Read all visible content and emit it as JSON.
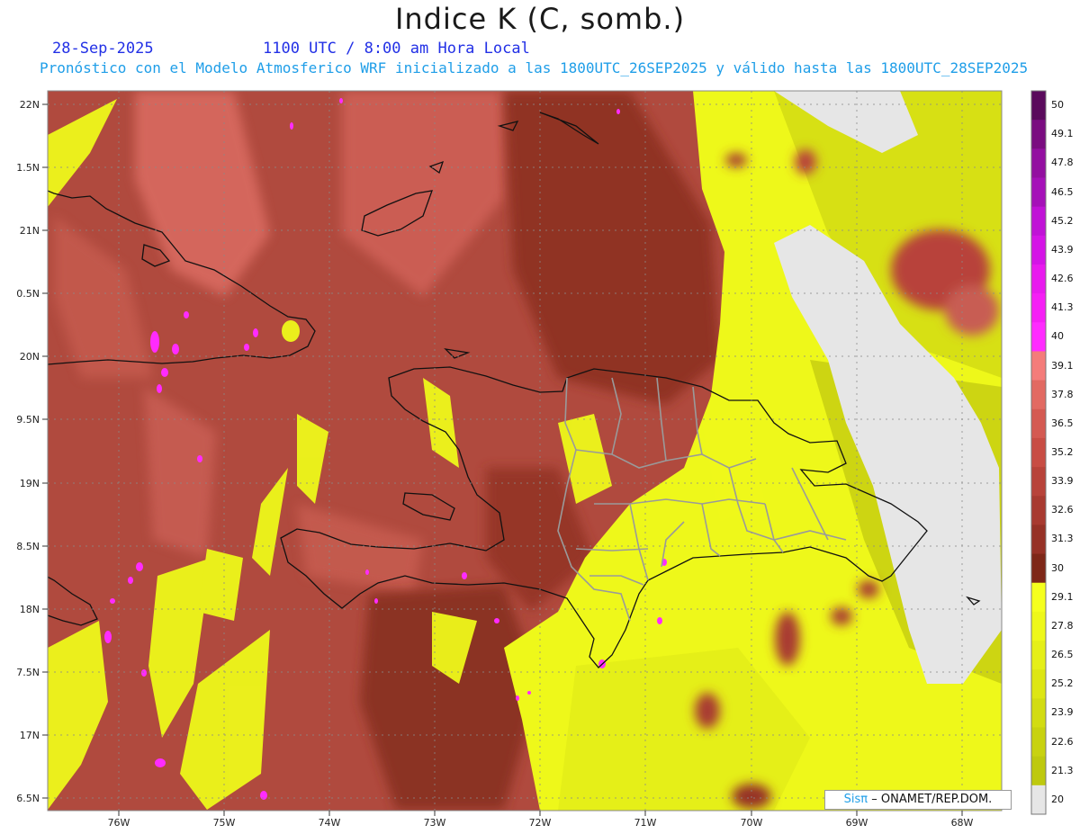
{
  "header": {
    "title": "Indice K (C, somb.)",
    "date": "28-Sep-2025",
    "time": "1100 UTC / 8:00 am Hora Local",
    "subtitle": "Pronóstico con el Modelo Atmosferico WRF inicializado a las 1800UTC_26SEP2025 y válido hasta las  1800UTC_28SEP2025"
  },
  "axes": {
    "lon_ticks": [
      "76W",
      "75W",
      "74W",
      "73W",
      "72W",
      "71W",
      "70W",
      "69W",
      "68W"
    ],
    "lat_ticks": [
      "22N",
      "1.5N",
      "21N",
      "0.5N",
      "20N",
      "9.5N",
      "19N",
      "8.5N",
      "18N",
      "7.5N",
      "17N",
      "6.5N"
    ]
  },
  "colorbar": {
    "labels": [
      "50",
      "49.1",
      "47.8",
      "46.5",
      "45.2",
      "43.9",
      "42.6",
      "41.3",
      "40",
      "39.1",
      "37.8",
      "36.5",
      "35.2",
      "33.9",
      "32.6",
      "31.3",
      "30",
      "29.1",
      "27.8",
      "26.5",
      "25.2",
      "23.9",
      "22.6",
      "21.3",
      "20"
    ],
    "colors": [
      "#5a0a5c",
      "#7a0c80",
      "#930fa0",
      "#a511b8",
      "#c012d6",
      "#d414e6",
      "#e81aee",
      "#f51ff5",
      "#ff2bff",
      "#f47c7a",
      "#e26a62",
      "#d45a52",
      "#c84d44",
      "#b8433a",
      "#a83a30",
      "#963126",
      "#7e2718",
      "#f5ff1e",
      "#eef81a",
      "#e5ef18",
      "#dde614",
      "#d2dc12",
      "#c8d210",
      "#bec90e",
      "#e6e6e6"
    ]
  },
  "credit": {
    "brand": "Sisπ",
    "org": "– ONAMET/REP.DOM."
  }
}
